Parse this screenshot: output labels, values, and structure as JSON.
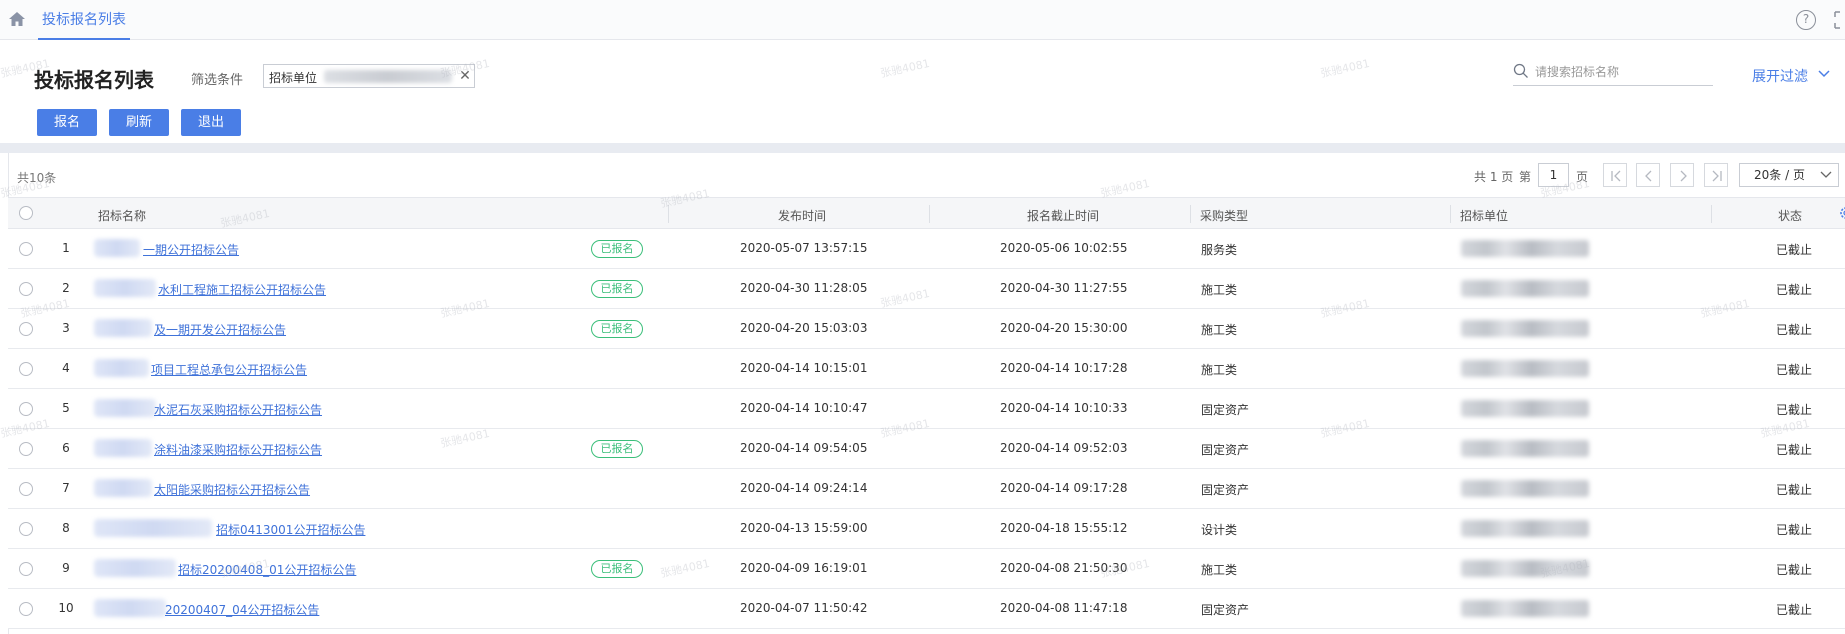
{
  "topbar": {
    "tab_label": "投标报名列表",
    "help_label": "?"
  },
  "header": {
    "title": "投标报名列表",
    "filter_label": "筛选条件",
    "filter_chip_label": "招标单位",
    "search_placeholder": "请搜索招标名称",
    "expand_filter_label": "展开过滤"
  },
  "toolbar": {
    "signup_label": "报名",
    "refresh_label": "刷新",
    "exit_label": "退出"
  },
  "table_meta": {
    "total_text": "共10条",
    "pages_text": "共 1 页",
    "page_prefix": "第",
    "page_value": "1",
    "page_suffix": "页",
    "page_size": "20条 / 页"
  },
  "columns": {
    "name": "招标名称",
    "publish_time": "发布时间",
    "deadline": "报名截止时间",
    "purchase_type": "采购类型",
    "unit": "招标单位",
    "status": "状态"
  },
  "rows": [
    {
      "index": "1",
      "name": "一期公开招标公告",
      "registered": "已报名",
      "publish_time": "2020-05-07 13:57:15",
      "deadline": "2020-05-06 10:02:55",
      "type": "服务类",
      "status": "已截止"
    },
    {
      "index": "2",
      "name": "水利工程施工招标公开招标公告",
      "registered": "已报名",
      "publish_time": "2020-04-30 11:28:05",
      "deadline": "2020-04-30 11:27:55",
      "type": "施工类",
      "status": "已截止"
    },
    {
      "index": "3",
      "name": "及一期开发公开招标公告",
      "registered": "已报名",
      "publish_time": "2020-04-20 15:03:03",
      "deadline": "2020-04-20 15:30:00",
      "type": "施工类",
      "status": "已截止"
    },
    {
      "index": "4",
      "name": "项目工程总承包公开招标公告",
      "registered": "",
      "publish_time": "2020-04-14 10:15:01",
      "deadline": "2020-04-14 10:17:28",
      "type": "施工类",
      "status": "已截止"
    },
    {
      "index": "5",
      "name": "水泥石灰采购招标公开招标公告",
      "registered": "",
      "publish_time": "2020-04-14 10:10:47",
      "deadline": "2020-04-14 10:10:33",
      "type": "固定资产",
      "status": "已截止"
    },
    {
      "index": "6",
      "name": "涂料油漆采购招标公开招标公告",
      "registered": "已报名",
      "publish_time": "2020-04-14 09:54:05",
      "deadline": "2020-04-14 09:52:03",
      "type": "固定资产",
      "status": "已截止"
    },
    {
      "index": "7",
      "name": "太阳能采购招标公开招标公告",
      "registered": "",
      "publish_time": "2020-04-14 09:24:14",
      "deadline": "2020-04-14 09:17:28",
      "type": "固定资产",
      "status": "已截止"
    },
    {
      "index": "8",
      "name": "招标0413001公开招标公告",
      "registered": "",
      "publish_time": "2020-04-13 15:59:00",
      "deadline": "2020-04-18 15:55:12",
      "type": "设计类",
      "status": "已截止"
    },
    {
      "index": "9",
      "name": "招标20200408_01公开招标公告",
      "registered": "已报名",
      "publish_time": "2020-04-09 16:19:01",
      "deadline": "2020-04-08 21:50:30",
      "type": "施工类",
      "status": "已截止"
    },
    {
      "index": "10",
      "name": "20200407_04公开招标公告",
      "registered": "",
      "publish_time": "2020-04-07 11:50:42",
      "deadline": "2020-04-08 11:47:18",
      "type": "固定资产",
      "status": "已截止"
    }
  ],
  "watermark_text": "张驰4081",
  "colors": {
    "accent": "#4a7ee6",
    "link": "#3f72d9",
    "badge_green": "#3bbf7a"
  }
}
